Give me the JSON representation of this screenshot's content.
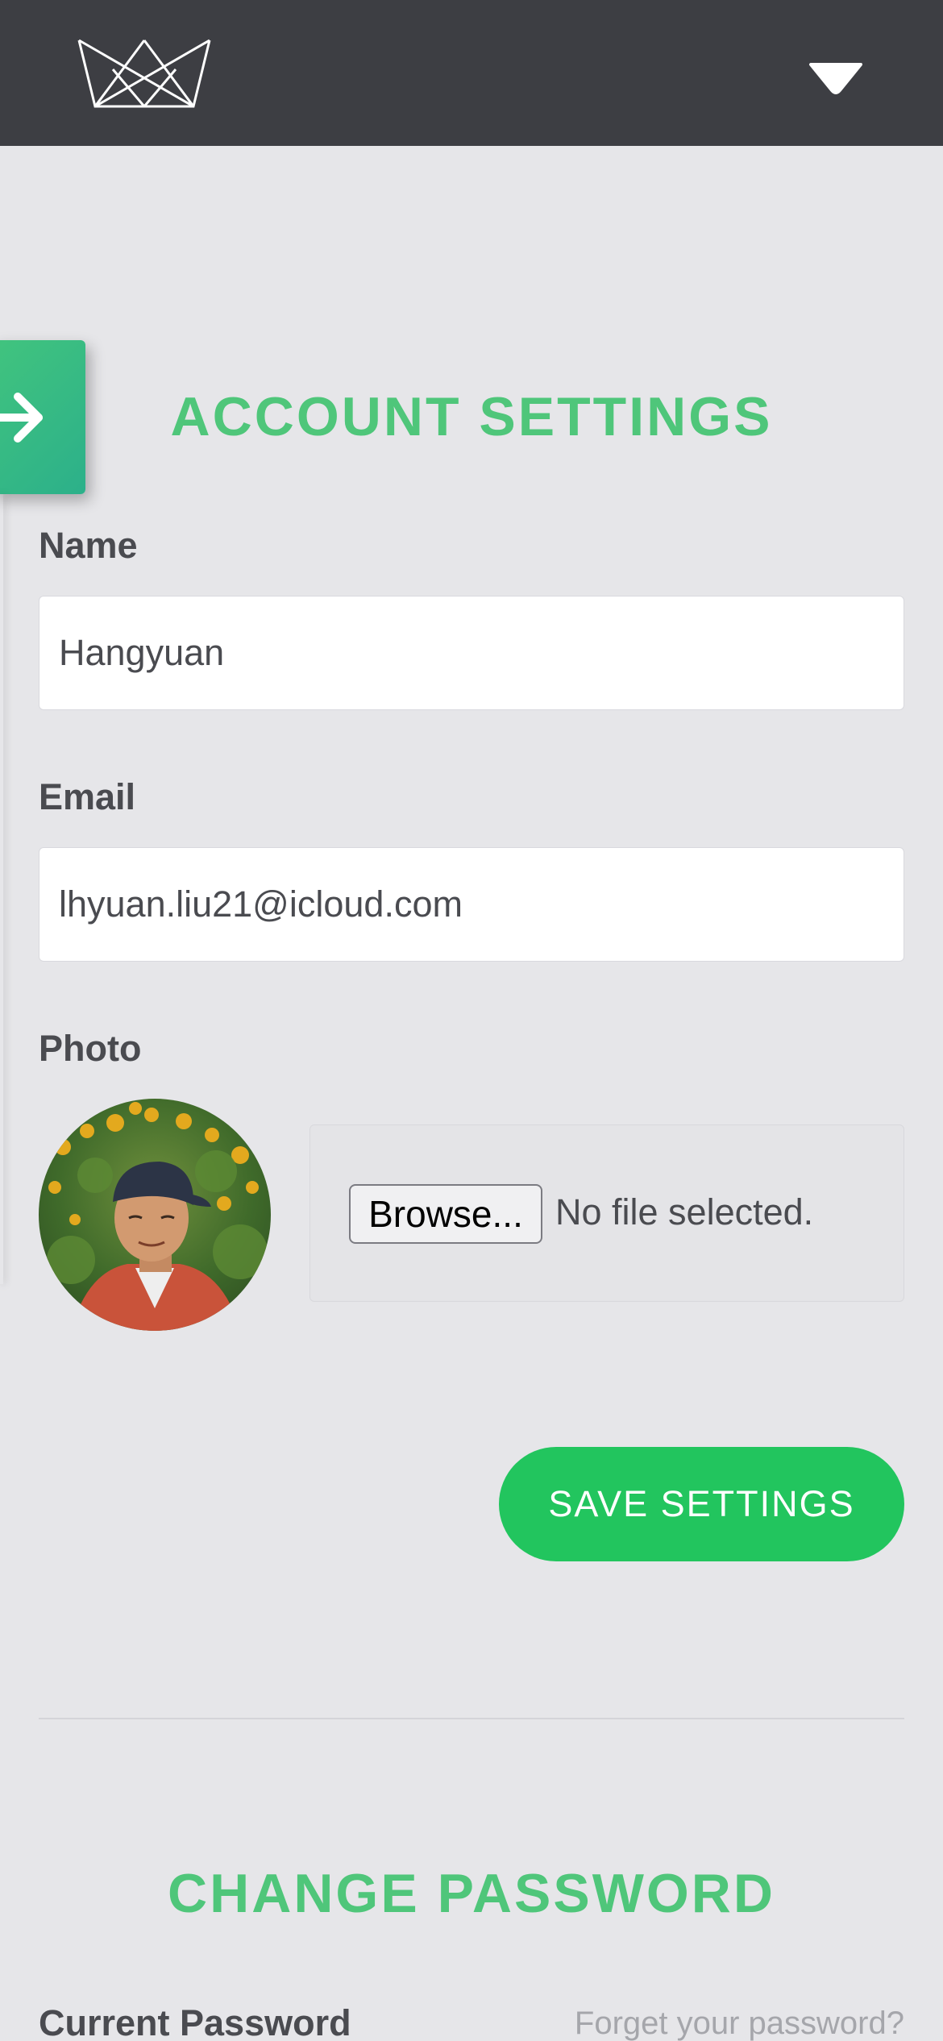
{
  "header": {
    "logo_icon": "crown-logo-icon",
    "menu_icon": "chevron-down-icon"
  },
  "side_nav": {
    "toggle_icon": "arrow-right-icon"
  },
  "account_settings": {
    "title": "ACCOUNT SETTINGS",
    "name_label": "Name",
    "name_value": "Hangyuan",
    "email_label": "Email",
    "email_value": "lhyuan.liu21@icloud.com",
    "photo_label": "Photo",
    "browse_label": "Browse...",
    "file_status": "No file selected.",
    "save_label": "SAVE SETTINGS"
  },
  "change_password": {
    "title": "CHANGE PASSWORD",
    "current_password_label": "Current Password",
    "forgot_link": "Forget your password?"
  },
  "colors": {
    "header_bg": "#3d3e43",
    "accent_green": "#4fc67a",
    "button_green": "#22c55e",
    "page_bg": "#e6e6e9"
  }
}
